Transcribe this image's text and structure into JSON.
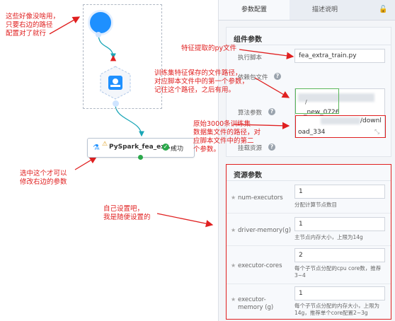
{
  "annotations": {
    "top_left": "这些好像没啥用，\n只要右边的路径\n配置对了就行",
    "select_node": "选中这个才可以\n修改右边的参数",
    "feature_file": "特征提取的py文件",
    "train_path": "训练集特征保存的文件路径，\n对应脚本文件中的第一个参数，\n记住这个路径，之后有用。",
    "raw_data": "原始3000条训练集\n数据集文件的路径，对\n应脚本文件中的第二\n个参数。",
    "resources": "自己设置吧，\n我是随便设置的"
  },
  "node": {
    "title": "PySpark_fea_ext...",
    "status": "成功"
  },
  "tabs": [
    "参数配置",
    "描述说明"
  ],
  "component_params": {
    "title": "组件参数",
    "script_label": "执行脚本",
    "script_value": "fea_extra_train.py",
    "dep_label": "依赖包文件",
    "algo_label": "算法参数",
    "algo_line1": "/",
    "algo_line2": "_new_0726",
    "algo_line3": "oad_334",
    "algo_partial": "/downl",
    "mount_label": "挂载资源"
  },
  "resource_params": {
    "title": "资源参数",
    "items": [
      {
        "label": "num-executors",
        "value": "1",
        "hint": "分配计算节点数目"
      },
      {
        "label": "driver-memory(g)",
        "value": "1",
        "hint": "主节点内存大小，上限为14g"
      },
      {
        "label": "executor-cores",
        "value": "2",
        "hint": "每个子节点分配的cpu core数，推荐3~4"
      },
      {
        "label": "executor-memory (g)",
        "value": "1",
        "hint": "每个子节点分配的内存大小，上限为14g，推荐单个core配置2~3g"
      }
    ]
  },
  "colors": {
    "accent": "#1e90ff",
    "annotation": "#e02020",
    "teal": "#1aa6b7"
  }
}
